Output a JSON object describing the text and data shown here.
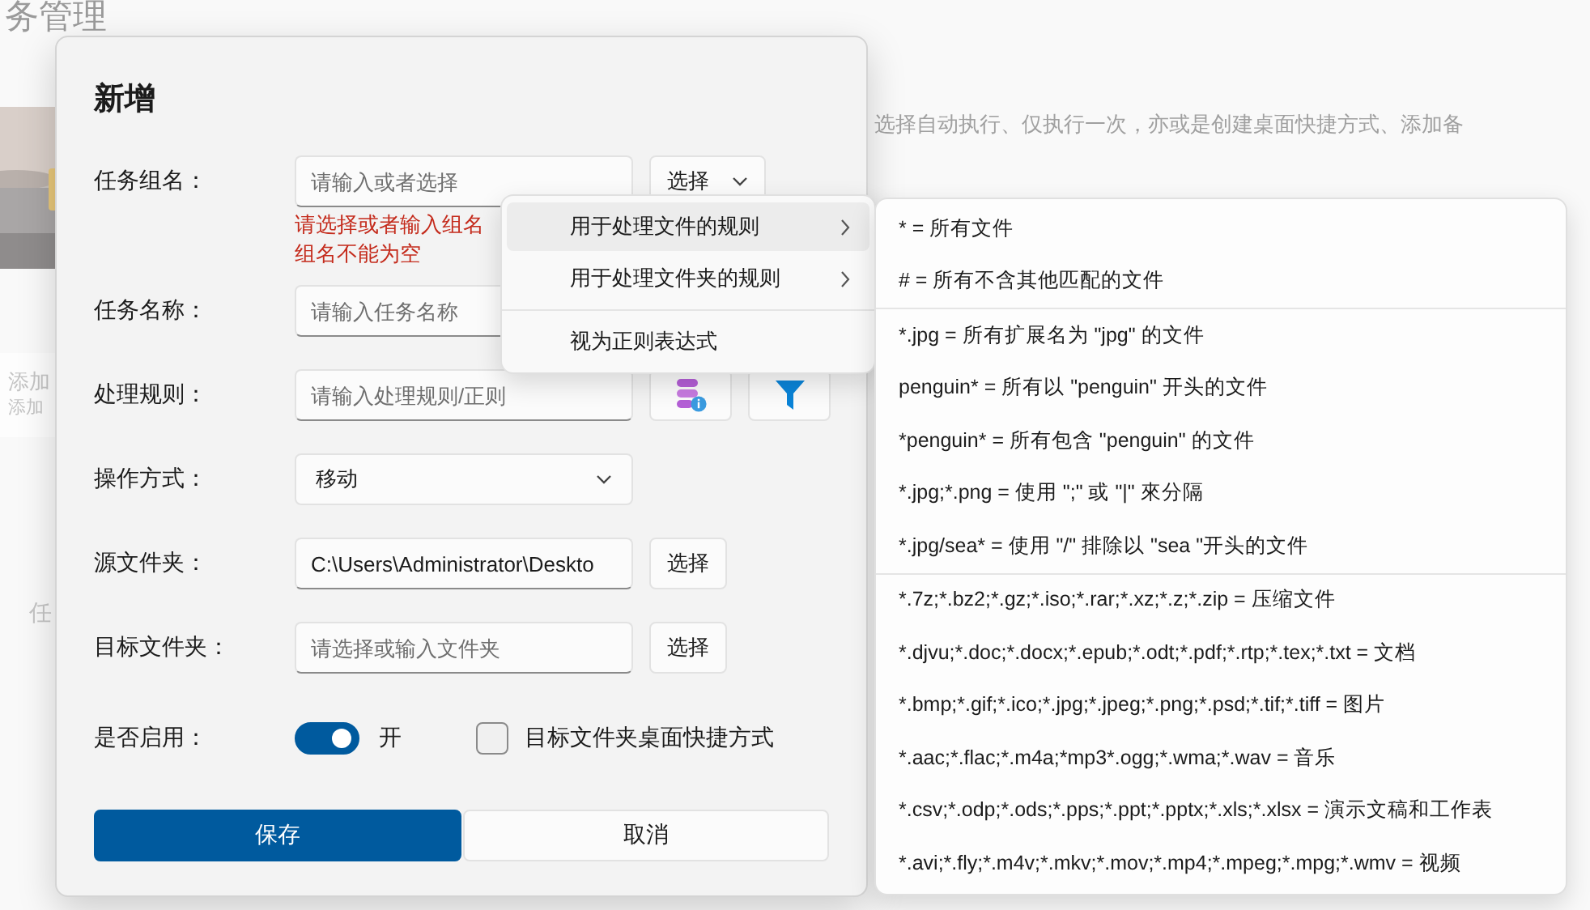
{
  "background": {
    "title_fragment": "务管理",
    "description_fragment": "选择自动执行、仅执行一次，亦或是创建桌面快捷方式、添加备",
    "card_fragments": [
      "添加",
      "添加"
    ],
    "label_fragment": "任"
  },
  "dialog": {
    "title": "新增",
    "fields": [
      {
        "kind": "combo",
        "label": "任务组名：",
        "placeholder": "请输入或者选择",
        "button": "选择",
        "errors": [
          "请选择或者输入组名",
          "组名不能为空"
        ]
      },
      {
        "kind": "text",
        "label": "任务名称：",
        "placeholder": "请输入任务名称"
      },
      {
        "kind": "rule",
        "label": "处理规则：",
        "placeholder": "请输入处理规则/正则"
      },
      {
        "kind": "dropdown",
        "label": "操作方式：",
        "value": "移动"
      },
      {
        "kind": "folder",
        "label": "源文件夹：",
        "value": "C:\\Users\\Administrator\\Deskto",
        "button": "选择"
      },
      {
        "kind": "folder",
        "label": "目标文件夹：",
        "placeholder": "请选择或输入文件夹",
        "button": "选择"
      }
    ],
    "enable": {
      "label": "是否启用：",
      "on": true,
      "state_text": "开"
    },
    "shortcut": {
      "label": "目标文件夹桌面快捷方式",
      "checked": false
    },
    "buttons": [
      {
        "label": "保存",
        "kind": "primary"
      },
      {
        "label": "取消",
        "kind": "secondary"
      }
    ]
  },
  "menu": {
    "items": [
      {
        "label": "用于处理文件的规则",
        "submenu": true,
        "highlighted": true
      },
      {
        "label": "用于处理文件夹的规则",
        "submenu": true,
        "highlighted": false
      },
      {
        "label": "视为正则表达式",
        "submenu": false,
        "highlighted": false
      }
    ]
  },
  "submenu": {
    "groups": [
      [
        "* = 所有文件",
        "# = 所有不含其他匹配的文件"
      ],
      [
        "*.jpg = 所有扩展名为 \"jpg\" 的文件",
        "penguin* = 所有以 \"penguin\" 开头的文件",
        "*penguin* = 所有包含 \"penguin\" 的文件",
        "*.jpg;*.png = 使用 \";\" 或 \"|\" 來分隔",
        "*.jpg/sea* = 使用 \"/\" 排除以 \"sea \"开头的文件"
      ],
      [
        "*.7z;*.bz2;*.gz;*.iso;*.rar;*.xz;*.z;*.zip = 压缩文件",
        "*.djvu;*.doc;*.docx;*.epub;*.odt;*.pdf;*.rtp;*.tex;*.txt = 文档",
        "*.bmp;*.gif;*.ico;*.jpg;*.jpeg;*.png;*.psd;*.tif;*.tiff = 图片",
        "*.aac;*.flac;*.m4a;*mp3*.ogg;*.wma;*.wav = 音乐",
        "*.csv;*.odp;*.ods;*.pps;*.ppt;*.pptx;*.xls;*.xlsx = 演示文稿和工作表",
        "*.avi;*.fly;*.m4v;*.mkv;*.mov;*.mp4;*.mpeg;*.mpg;*.wmv = 视频"
      ]
    ]
  }
}
